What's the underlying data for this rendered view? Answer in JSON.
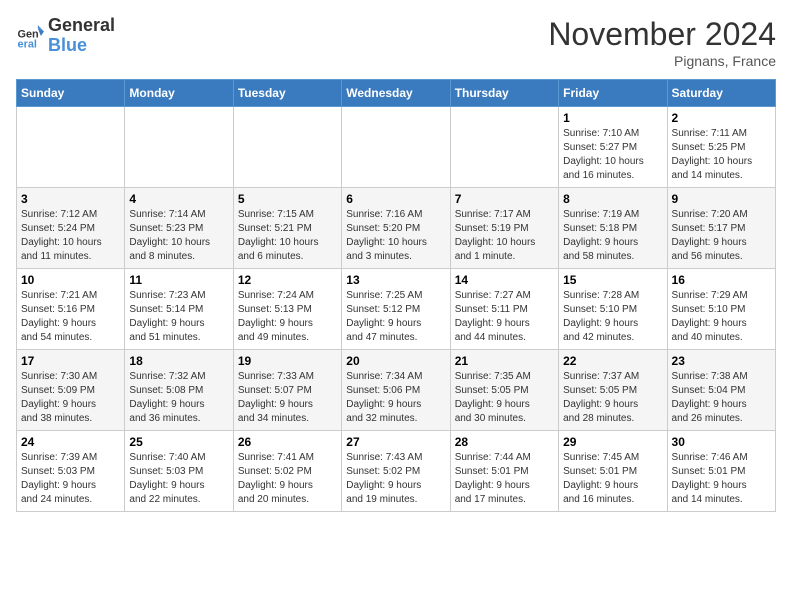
{
  "header": {
    "logo_line1": "General",
    "logo_line2": "Blue",
    "month": "November 2024",
    "location": "Pignans, France"
  },
  "weekdays": [
    "Sunday",
    "Monday",
    "Tuesday",
    "Wednesday",
    "Thursday",
    "Friday",
    "Saturday"
  ],
  "weeks": [
    [
      {
        "day": "",
        "info": ""
      },
      {
        "day": "",
        "info": ""
      },
      {
        "day": "",
        "info": ""
      },
      {
        "day": "",
        "info": ""
      },
      {
        "day": "",
        "info": ""
      },
      {
        "day": "1",
        "info": "Sunrise: 7:10 AM\nSunset: 5:27 PM\nDaylight: 10 hours\nand 16 minutes."
      },
      {
        "day": "2",
        "info": "Sunrise: 7:11 AM\nSunset: 5:25 PM\nDaylight: 10 hours\nand 14 minutes."
      }
    ],
    [
      {
        "day": "3",
        "info": "Sunrise: 7:12 AM\nSunset: 5:24 PM\nDaylight: 10 hours\nand 11 minutes."
      },
      {
        "day": "4",
        "info": "Sunrise: 7:14 AM\nSunset: 5:23 PM\nDaylight: 10 hours\nand 8 minutes."
      },
      {
        "day": "5",
        "info": "Sunrise: 7:15 AM\nSunset: 5:21 PM\nDaylight: 10 hours\nand 6 minutes."
      },
      {
        "day": "6",
        "info": "Sunrise: 7:16 AM\nSunset: 5:20 PM\nDaylight: 10 hours\nand 3 minutes."
      },
      {
        "day": "7",
        "info": "Sunrise: 7:17 AM\nSunset: 5:19 PM\nDaylight: 10 hours\nand 1 minute."
      },
      {
        "day": "8",
        "info": "Sunrise: 7:19 AM\nSunset: 5:18 PM\nDaylight: 9 hours\nand 58 minutes."
      },
      {
        "day": "9",
        "info": "Sunrise: 7:20 AM\nSunset: 5:17 PM\nDaylight: 9 hours\nand 56 minutes."
      }
    ],
    [
      {
        "day": "10",
        "info": "Sunrise: 7:21 AM\nSunset: 5:16 PM\nDaylight: 9 hours\nand 54 minutes."
      },
      {
        "day": "11",
        "info": "Sunrise: 7:23 AM\nSunset: 5:14 PM\nDaylight: 9 hours\nand 51 minutes."
      },
      {
        "day": "12",
        "info": "Sunrise: 7:24 AM\nSunset: 5:13 PM\nDaylight: 9 hours\nand 49 minutes."
      },
      {
        "day": "13",
        "info": "Sunrise: 7:25 AM\nSunset: 5:12 PM\nDaylight: 9 hours\nand 47 minutes."
      },
      {
        "day": "14",
        "info": "Sunrise: 7:27 AM\nSunset: 5:11 PM\nDaylight: 9 hours\nand 44 minutes."
      },
      {
        "day": "15",
        "info": "Sunrise: 7:28 AM\nSunset: 5:10 PM\nDaylight: 9 hours\nand 42 minutes."
      },
      {
        "day": "16",
        "info": "Sunrise: 7:29 AM\nSunset: 5:10 PM\nDaylight: 9 hours\nand 40 minutes."
      }
    ],
    [
      {
        "day": "17",
        "info": "Sunrise: 7:30 AM\nSunset: 5:09 PM\nDaylight: 9 hours\nand 38 minutes."
      },
      {
        "day": "18",
        "info": "Sunrise: 7:32 AM\nSunset: 5:08 PM\nDaylight: 9 hours\nand 36 minutes."
      },
      {
        "day": "19",
        "info": "Sunrise: 7:33 AM\nSunset: 5:07 PM\nDaylight: 9 hours\nand 34 minutes."
      },
      {
        "day": "20",
        "info": "Sunrise: 7:34 AM\nSunset: 5:06 PM\nDaylight: 9 hours\nand 32 minutes."
      },
      {
        "day": "21",
        "info": "Sunrise: 7:35 AM\nSunset: 5:05 PM\nDaylight: 9 hours\nand 30 minutes."
      },
      {
        "day": "22",
        "info": "Sunrise: 7:37 AM\nSunset: 5:05 PM\nDaylight: 9 hours\nand 28 minutes."
      },
      {
        "day": "23",
        "info": "Sunrise: 7:38 AM\nSunset: 5:04 PM\nDaylight: 9 hours\nand 26 minutes."
      }
    ],
    [
      {
        "day": "24",
        "info": "Sunrise: 7:39 AM\nSunset: 5:03 PM\nDaylight: 9 hours\nand 24 minutes."
      },
      {
        "day": "25",
        "info": "Sunrise: 7:40 AM\nSunset: 5:03 PM\nDaylight: 9 hours\nand 22 minutes."
      },
      {
        "day": "26",
        "info": "Sunrise: 7:41 AM\nSunset: 5:02 PM\nDaylight: 9 hours\nand 20 minutes."
      },
      {
        "day": "27",
        "info": "Sunrise: 7:43 AM\nSunset: 5:02 PM\nDaylight: 9 hours\nand 19 minutes."
      },
      {
        "day": "28",
        "info": "Sunrise: 7:44 AM\nSunset: 5:01 PM\nDaylight: 9 hours\nand 17 minutes."
      },
      {
        "day": "29",
        "info": "Sunrise: 7:45 AM\nSunset: 5:01 PM\nDaylight: 9 hours\nand 16 minutes."
      },
      {
        "day": "30",
        "info": "Sunrise: 7:46 AM\nSunset: 5:01 PM\nDaylight: 9 hours\nand 14 minutes."
      }
    ]
  ]
}
